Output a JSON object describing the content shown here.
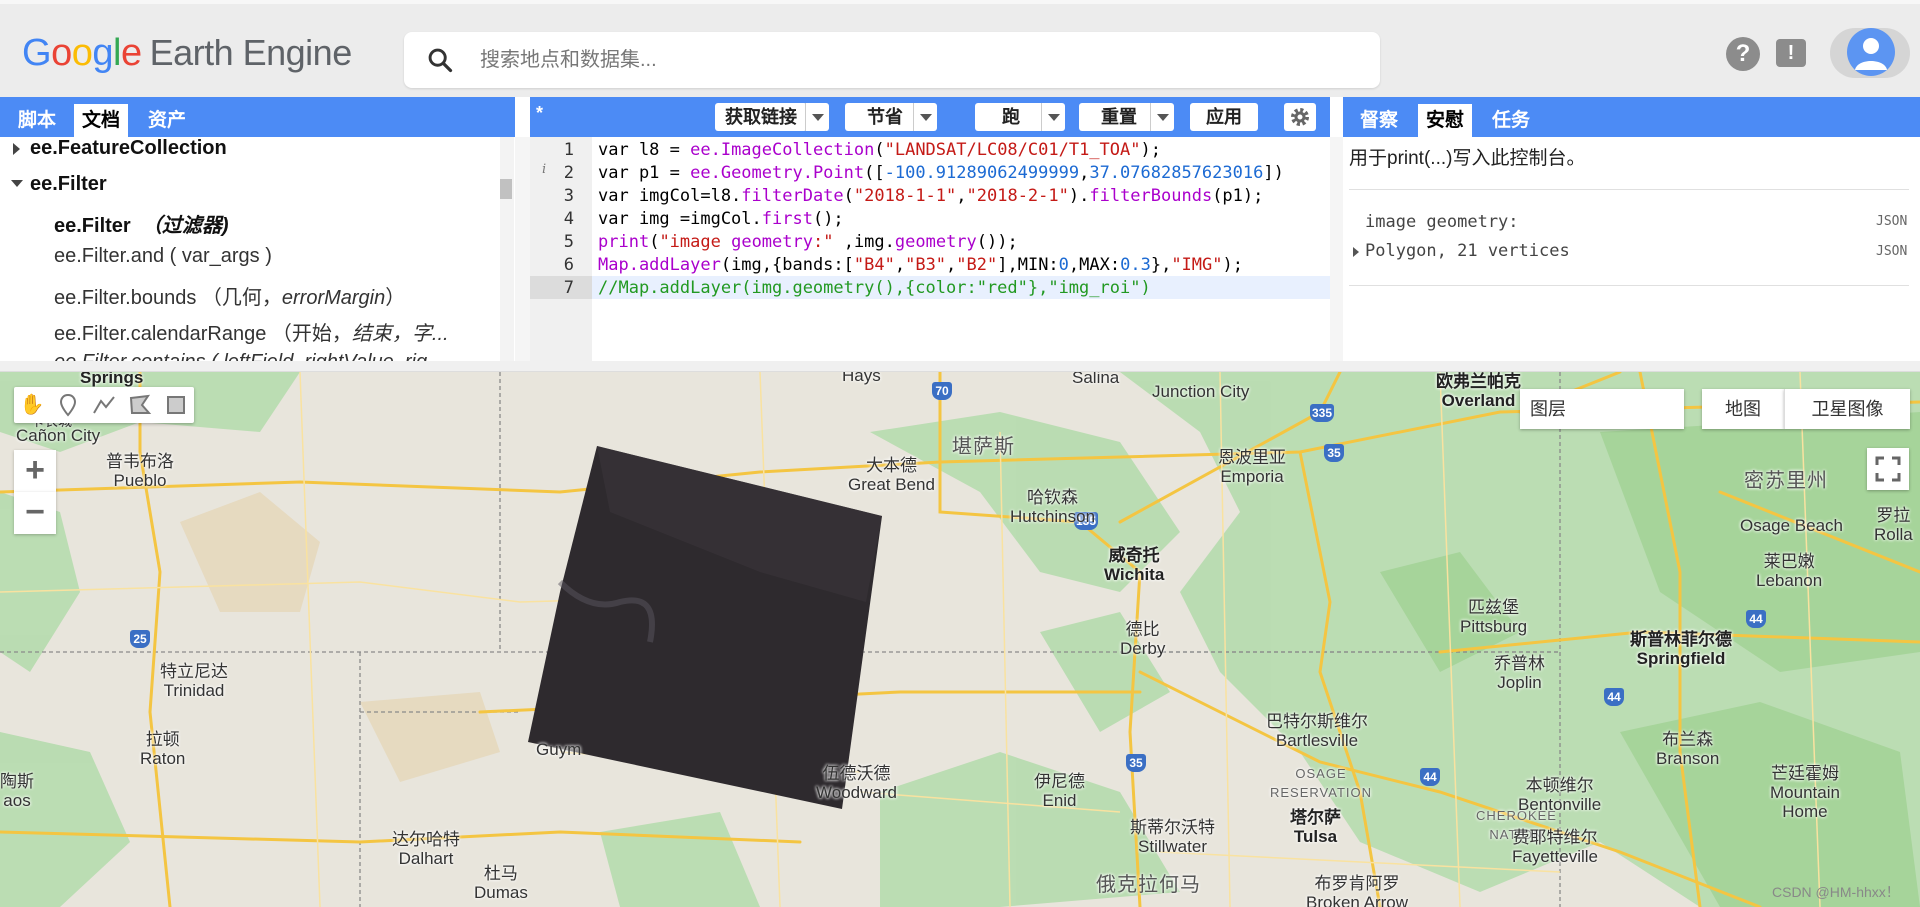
{
  "header": {
    "logo_parts": [
      "G",
      "o",
      "o",
      "g",
      "l",
      "e"
    ],
    "logo_suffix": "Earth Engine",
    "search_placeholder": "搜索地点和数据集..."
  },
  "left_panel": {
    "tabs": [
      "脚本",
      "文档",
      "资产"
    ],
    "active_tab": "文档",
    "items": [
      {
        "label": "ee.FeatureCollection",
        "level": 0,
        "expanded": false
      },
      {
        "label": "ee.Filter",
        "level": 0,
        "expanded": true
      },
      {
        "label": "ee.Filter",
        "italic_suffix": "（过滤器)",
        "level": 1
      },
      {
        "label": "ee.Filter.and ( var_args )",
        "level": 1
      },
      {
        "label": "ee.Filter.bounds （几何，",
        "italic_suffix": "errorMargin",
        "tail": "）",
        "level": 1
      },
      {
        "label": "ee.Filter.calendarRange （开始，",
        "italic_suffix": "结束，字...",
        "level": 1
      },
      {
        "label": "ee.Filter.contains ( leftField, rightValue, rig",
        "level": 1
      }
    ]
  },
  "editor": {
    "file_marker": "*",
    "buttons": {
      "get_link": "获取链接",
      "save": "节省",
      "run": "跑",
      "reset": "重置",
      "apply": "应用"
    },
    "lines": [
      "var l8 = ee.ImageCollection(\"LANDSAT/LC08/C01/T1_TOA\");",
      "var p1 = ee.Geometry.Point([-100.91289062499999,37.07682857623016])",
      "var imgCol=l8.filterDate(\"2018-1-1\",\"2018-2-1\").filterBounds(p1);",
      "var img =imgCol.first();",
      "print(\"image geometry:\" ,img.geometry());",
      "Map.addLayer(img,{bands:[\"B4\",\"B3\",\"B2\"],MIN:0,MAX:0.3},\"IMG\");",
      "//Map.addLayer(img.geometry(),{color:\"red\"},\"img_roi\")"
    ],
    "line_numbers": [
      "1",
      "2",
      "3",
      "4",
      "5",
      "6",
      "7"
    ],
    "info_marker": "i"
  },
  "right_panel": {
    "tabs": [
      "督察",
      "安慰",
      "任务"
    ],
    "active_tab": "安慰",
    "console_hint": "用于print(...)写入此控制台。",
    "output": [
      {
        "text": "image geometry:",
        "tag": "JSON"
      },
      {
        "text": "Polygon, 21 vertices",
        "tag": "JSON",
        "expandable": true
      }
    ]
  },
  "map": {
    "layers_label": "图层",
    "map_type_buttons": [
      "地图",
      "卫星图像"
    ],
    "labels": [
      {
        "text": "Springs",
        "bold": true
      },
      {
        "text": "卡农城"
      },
      {
        "text": "Cañon City"
      },
      {
        "text": "普韦布洛\nPueblo"
      },
      {
        "text": "特立尼达\nTrinidad"
      },
      {
        "text": "拉顿\nRaton"
      },
      {
        "text": "陶斯\naos"
      },
      {
        "text": "达尔哈特\nDalhart"
      },
      {
        "text": "杜马\nDumas"
      },
      {
        "text": "Guym"
      },
      {
        "text": "伍德沃德\nWoodward"
      },
      {
        "text": "Hays"
      },
      {
        "text": "Salina"
      },
      {
        "text": "堪萨斯"
      },
      {
        "text": "大本德\nGreat Bend"
      },
      {
        "text": "哈钦森\nHutchinson"
      },
      {
        "text": "Junction City"
      },
      {
        "text": "恩波里亚\nEmporia"
      },
      {
        "text": "威奇托\nWichita"
      },
      {
        "text": "德比\nDerby"
      },
      {
        "text": "伊尼德\nEnid"
      },
      {
        "text": "斯蒂尔沃特\nStillwater"
      },
      {
        "text": "俄克拉何马"
      },
      {
        "text": "巴特尔斯维尔\nBartlesville"
      },
      {
        "text": "OSAGE\nRESERVATION"
      },
      {
        "text": "塔尔萨\nTulsa"
      },
      {
        "text": "布罗肯阿罗\nBroken Arrow"
      },
      {
        "text": "CHEROKEE\nNATION"
      },
      {
        "text": "费耶特维尔\nFayetteville"
      },
      {
        "text": "本顿维尔\nBentonville"
      },
      {
        "text": "匹兹堡\nPittsburg"
      },
      {
        "text": "乔普林\nJoplin"
      },
      {
        "text": "斯普林菲尔德\nSpringfield"
      },
      {
        "text": "欧弗兰帕克\nOverland"
      },
      {
        "text": "密苏里州"
      },
      {
        "text": "Osage Beach"
      },
      {
        "text": "莱巴嫩\nLebanon"
      },
      {
        "text": "罗拉\nRolla"
      },
      {
        "text": "布兰森\nBranson"
      },
      {
        "text": "芒廷霍姆\nMountain\nHome"
      }
    ],
    "shields": [
      "70",
      "335",
      "35",
      "135",
      "25",
      "44",
      "35",
      "44",
      "44"
    ],
    "watermark": "CSDN @HM-hhxx！"
  }
}
